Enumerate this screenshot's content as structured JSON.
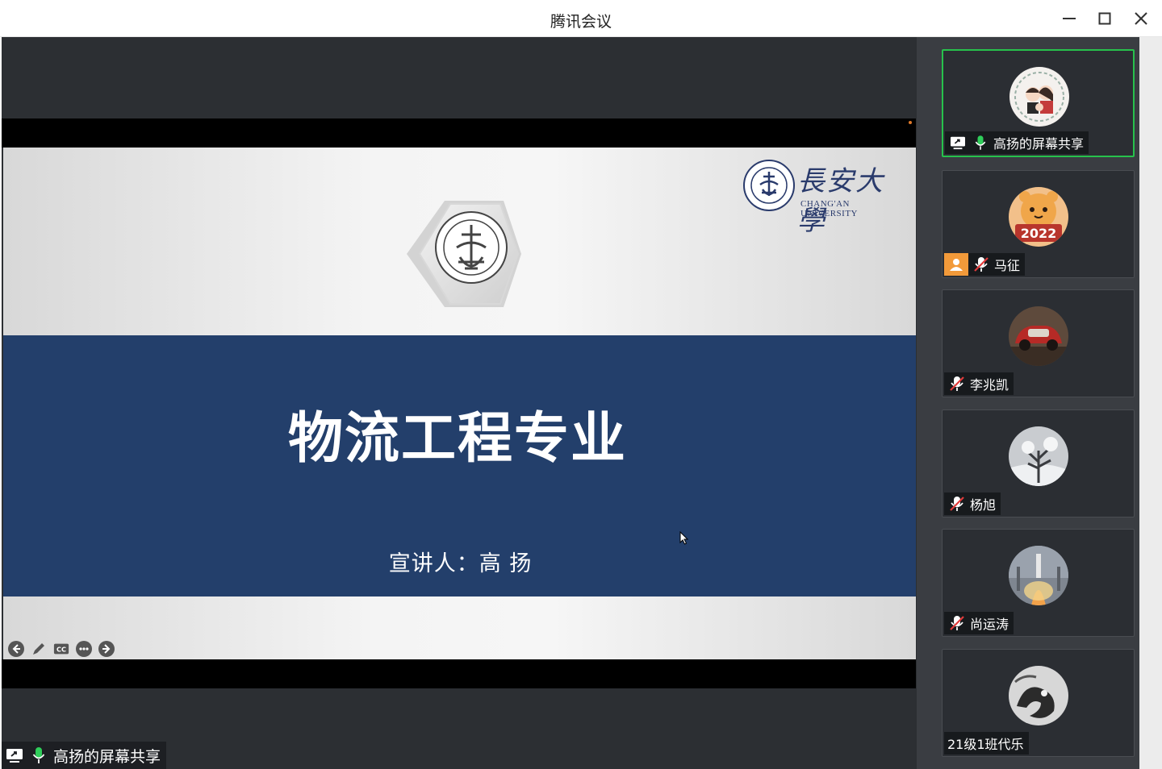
{
  "window": {
    "title": "腾讯会议"
  },
  "slide": {
    "main_title": "物流工程专业",
    "presenter": "宣讲人：高 扬",
    "university_cn": "長安大學",
    "university_en": "CHANG'AN UNIVERSITY"
  },
  "share": {
    "label": "高扬的屏幕共享"
  },
  "colors": {
    "accent_green": "#27c24c",
    "slide_band": "#233f6b",
    "mic_green": "#2fce5a"
  },
  "participants": [
    {
      "name": "高扬的屏幕共享",
      "mic": "on",
      "sharing": true,
      "active": true,
      "avatar": "couple-cartoon"
    },
    {
      "name": "马征",
      "mic": "muted",
      "sharing": false,
      "active": false,
      "avatar": "tiger-2022",
      "badge": "person-icon"
    },
    {
      "name": "李兆凯",
      "mic": "muted",
      "sharing": false,
      "active": false,
      "avatar": "red-car"
    },
    {
      "name": "杨旭",
      "mic": "muted",
      "sharing": false,
      "active": false,
      "avatar": "snow-tree"
    },
    {
      "name": "尚运涛",
      "mic": "muted",
      "sharing": false,
      "active": false,
      "avatar": "rocket-launch"
    },
    {
      "name": "21级1班代乐",
      "mic": "none",
      "sharing": false,
      "active": false,
      "avatar": "dragon-ink"
    }
  ],
  "avatar_texts": {
    "tiger_year": "2022"
  }
}
